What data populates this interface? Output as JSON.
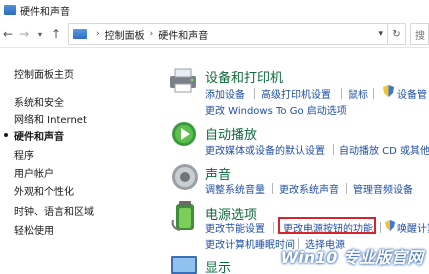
{
  "window": {
    "title": "硬件和声音"
  },
  "address": {
    "back_icon": "arrow-left-icon",
    "forward_icon": "arrow-right-icon",
    "up_icon": "arrow-up-icon",
    "crumbs": [
      "控制面板",
      "硬件和声音"
    ],
    "refresh_icon": "refresh-icon",
    "search_placeholder": "搜"
  },
  "leftnav": {
    "home": "控制面板主页",
    "items": [
      "系统和安全",
      "网络和 Internet",
      "硬件和声音",
      "程序",
      "用户帐户",
      "外观和个性化",
      "时钟、语言和区域",
      "轻松使用"
    ],
    "active_index": 2
  },
  "sections": [
    {
      "title": "设备和打印机",
      "links_row1": [
        "添加设备",
        "高级打印机设置",
        "鼠标",
        "设备管"
      ],
      "links_row2": [
        "更改 Windows To Go 启动选项"
      ]
    },
    {
      "title": "自动播放",
      "links_row1": [
        "更改媒体或设备的默认设置",
        "自动播放 CD 或其他媒体"
      ]
    },
    {
      "title": "声音",
      "links_row1": [
        "调整系统音量",
        "更改系统声音",
        "管理音频设备"
      ]
    },
    {
      "title": "电源选项",
      "links_row1": [
        "更改节能设置",
        "更改电源按钮的功能",
        "唤醒计算"
      ],
      "links_row2": [
        "更改计算机睡眠时间",
        "选择电源"
      ]
    },
    {
      "title": "显示"
    }
  ],
  "watermark": "Win10 专业版官网",
  "colors": {
    "link": "#1f4fa8",
    "section_title": "#0d6b3a",
    "highlight": "#d9232a"
  }
}
